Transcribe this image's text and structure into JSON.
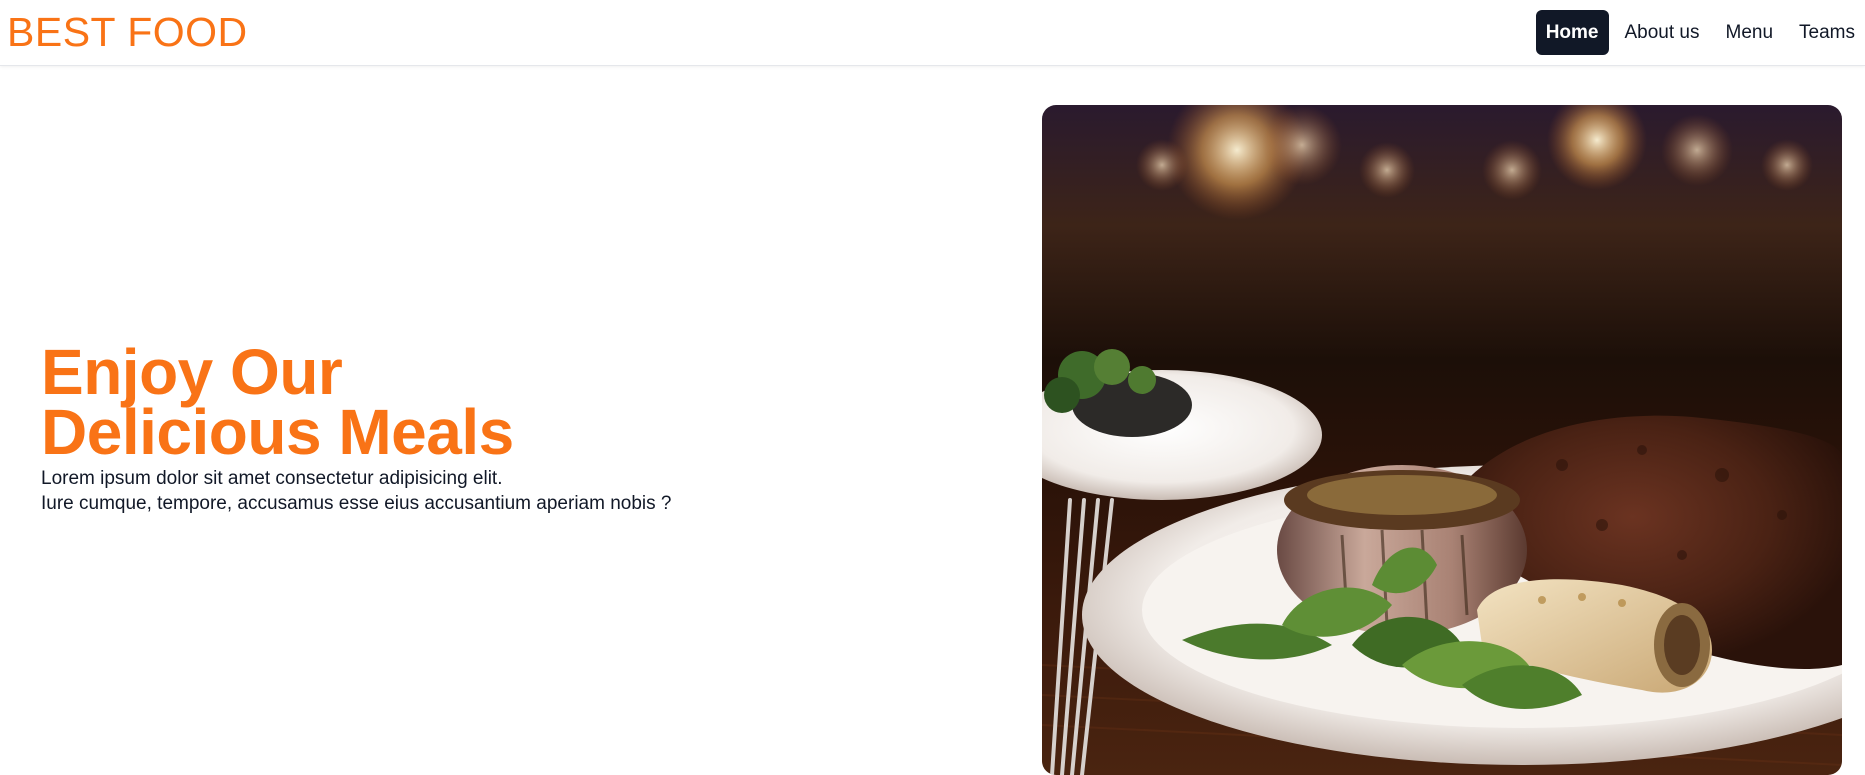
{
  "navbar": {
    "brand": "BEST FOOD",
    "links": [
      {
        "label": "Home",
        "active": true
      },
      {
        "label": "About us",
        "active": false
      },
      {
        "label": "Menu",
        "active": false
      },
      {
        "label": "Teams",
        "active": false
      }
    ]
  },
  "hero": {
    "title_line1": "Enjoy Our",
    "title_line2": "Delicious Meals",
    "desc_line1": "Lorem ipsum dolor sit amet consectetur adipisicing elit.",
    "desc_line2": "Iure cumque, tempore, accusamus esse eius accusantium aperiam nobis ?",
    "image_subject": "steak-dinner-photo"
  },
  "colors": {
    "accent": "#f97316",
    "nav_active_bg": "#111827",
    "text": "#111827"
  }
}
